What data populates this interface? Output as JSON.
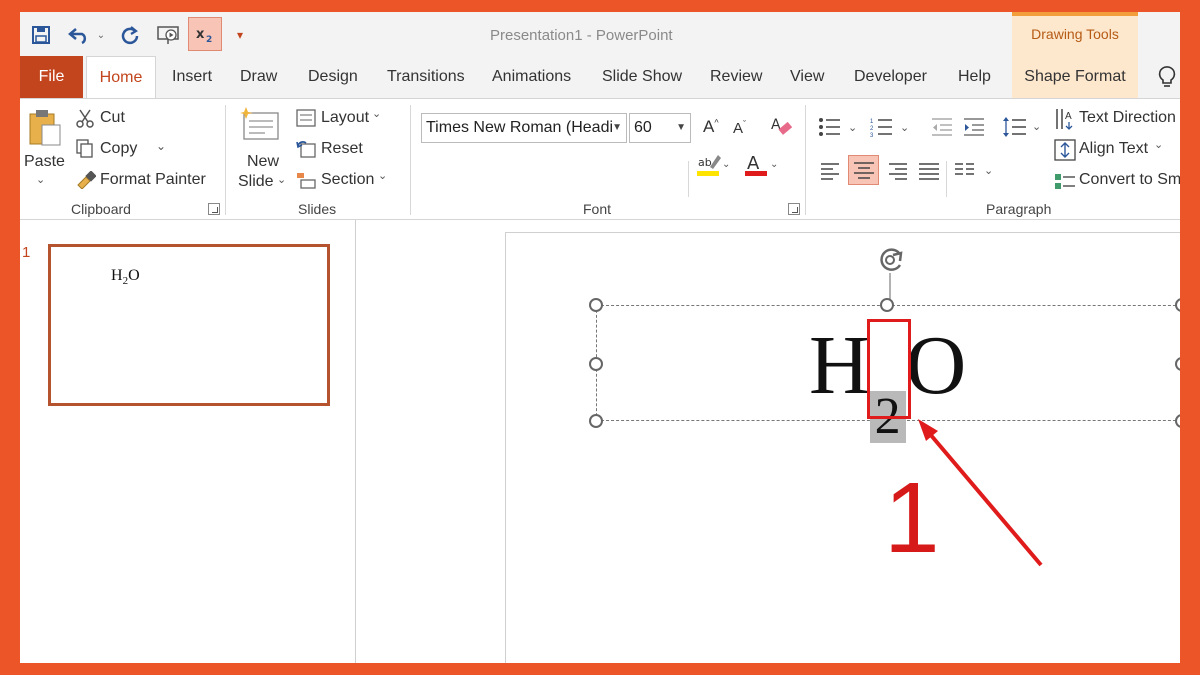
{
  "window": {
    "title": "Presentation1  -  PowerPoint",
    "drawing_tools": "Drawing Tools"
  },
  "tabs": [
    "File",
    "Home",
    "Insert",
    "Draw",
    "Design",
    "Transitions",
    "Animations",
    "Slide Show",
    "Review",
    "View",
    "Developer",
    "Help",
    "Shape Format"
  ],
  "clipboard": {
    "paste": "Paste",
    "cut": "Cut",
    "copy": "Copy",
    "format_painter": "Format Painter",
    "label": "Clipboard"
  },
  "slides": {
    "new_slide_1": "New",
    "new_slide_2": "Slide",
    "layout": "Layout",
    "reset": "Reset",
    "section": "Section",
    "label": "Slides"
  },
  "font": {
    "name": "Times New Roman (Headi",
    "size": "60",
    "label": "Font"
  },
  "paragraph": {
    "text_direction": "Text Direction",
    "align_text": "Align Text",
    "convert": "Convert to Sm",
    "label": "Paragraph"
  },
  "thumbnail": {
    "number": "1",
    "text_h": "H",
    "text_sub": "2",
    "text_o": "O"
  },
  "slide": {
    "text_h": "H",
    "text_sub": "2",
    "text_o": "O"
  },
  "annotation": {
    "number": "1"
  },
  "colors": {
    "accent": "#c2451d",
    "frame": "#ec5527",
    "highlight_red": "#e01b1b"
  }
}
